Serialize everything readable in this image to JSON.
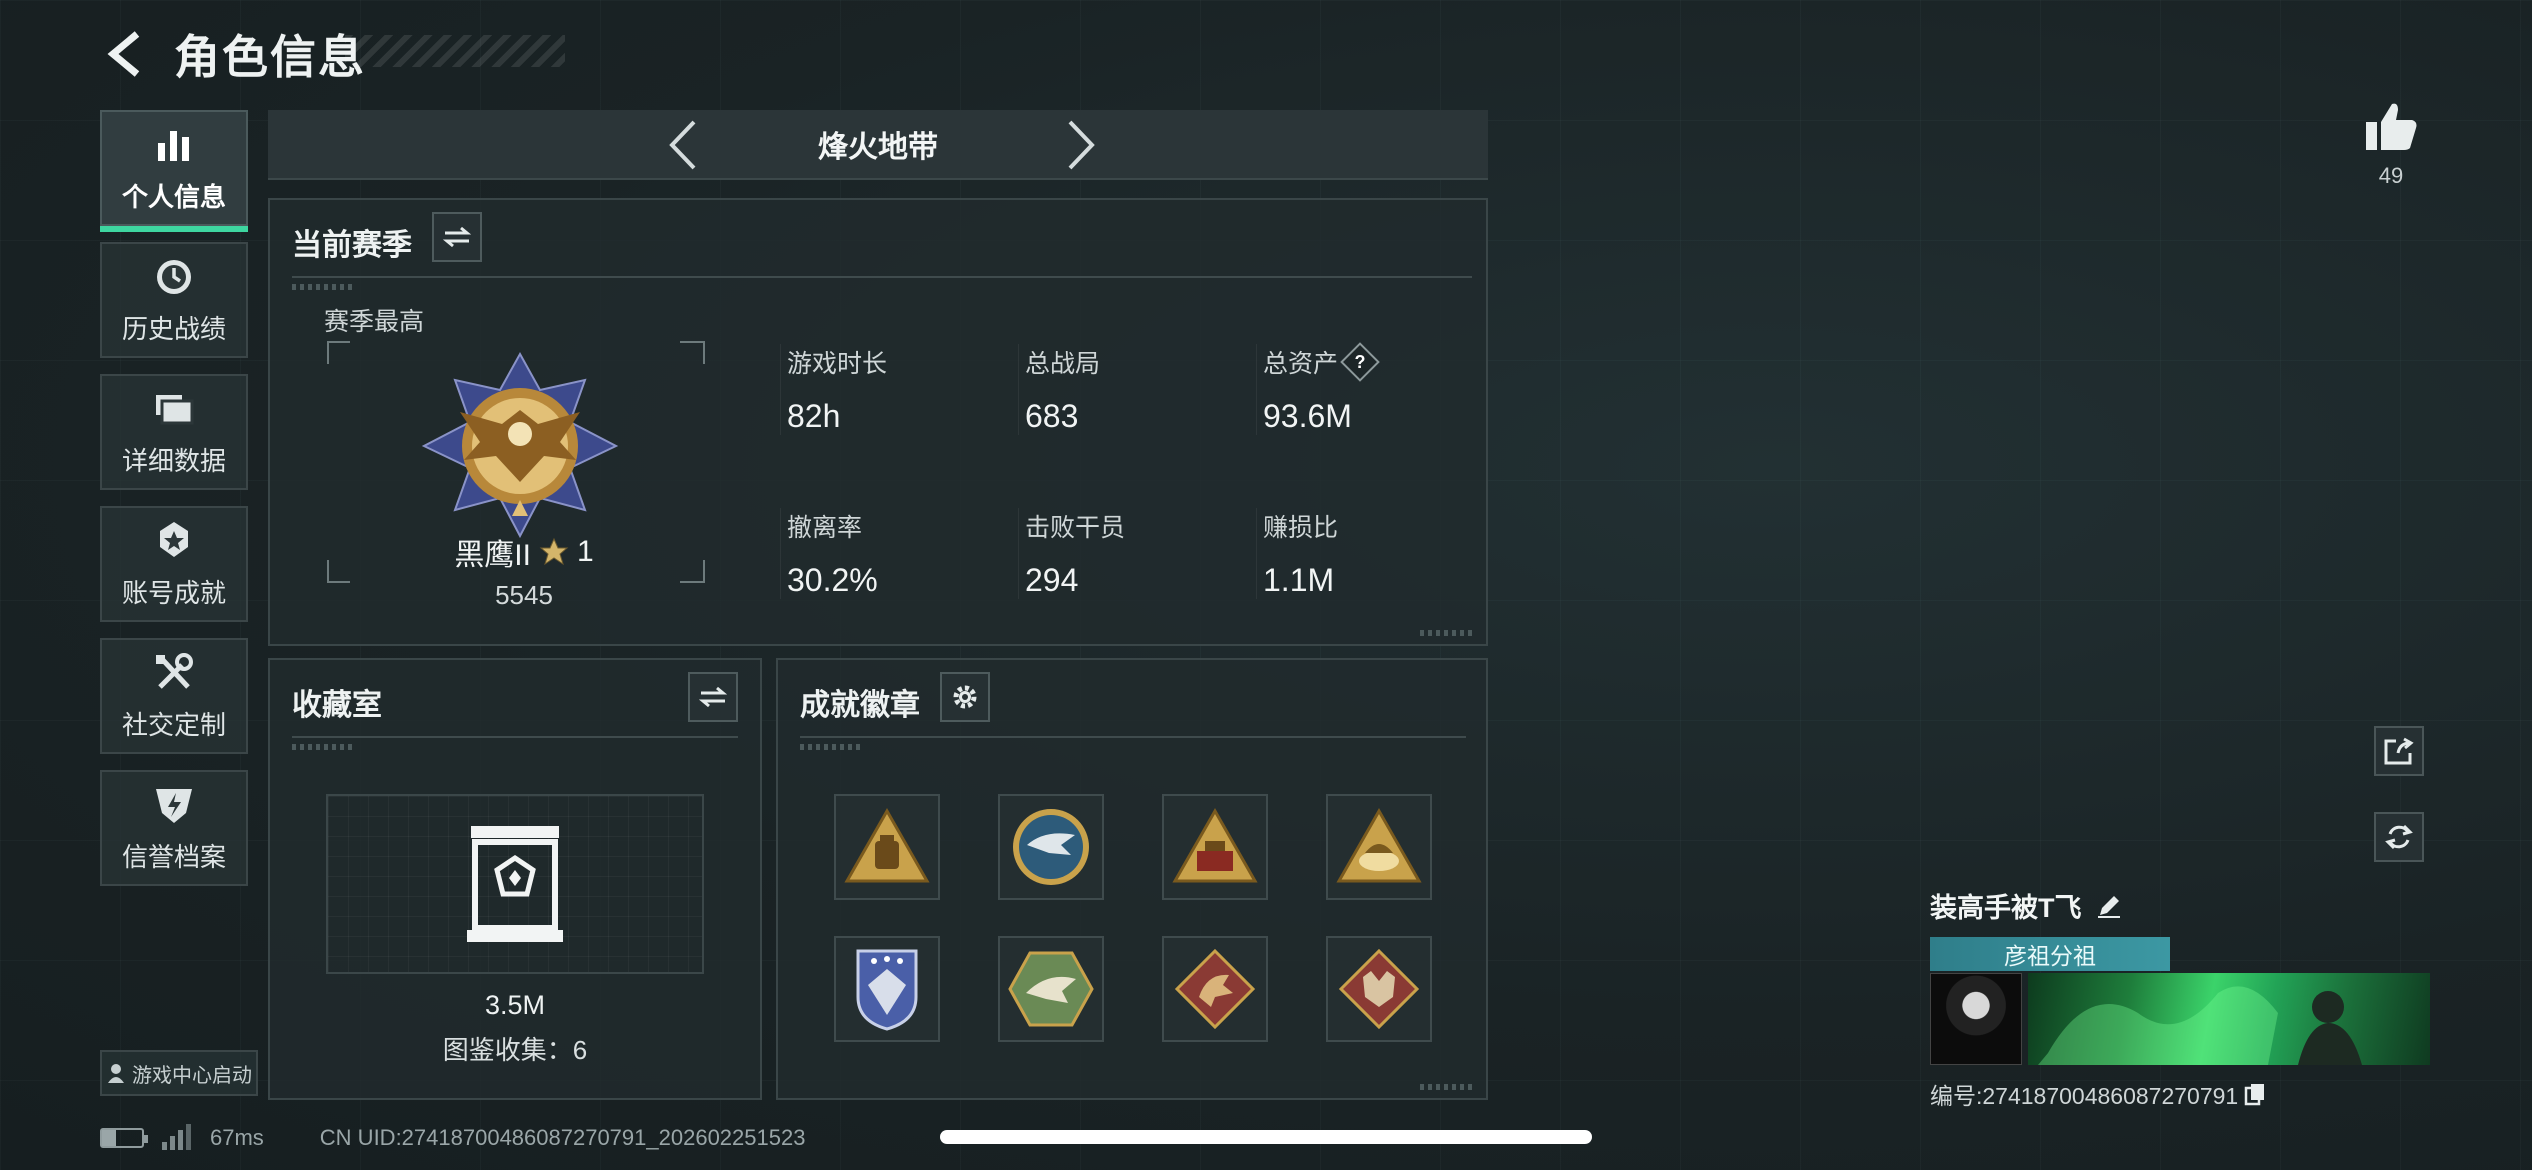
{
  "header": {
    "title": "角色信息"
  },
  "nav": {
    "items": [
      {
        "label": "个人信息",
        "icon": "bar-chart-icon",
        "active": true
      },
      {
        "label": "历史战绩",
        "icon": "clock-icon",
        "active": false
      },
      {
        "label": "详细数据",
        "icon": "folders-icon",
        "active": false
      },
      {
        "label": "账号成就",
        "icon": "medal-icon",
        "active": false
      },
      {
        "label": "社交定制",
        "icon": "tools-icon",
        "active": false
      },
      {
        "label": "信誉档案",
        "icon": "shield-icon",
        "active": false
      }
    ],
    "launch_label": "游戏中心启动"
  },
  "mode": {
    "title": "烽火地带"
  },
  "season": {
    "title": "当前赛季",
    "best_label": "赛季最高",
    "rank_name": "黑鹰II",
    "rank_stars": "1",
    "rank_points": "5545",
    "stats": [
      {
        "label": "游戏时长",
        "value": "82h"
      },
      {
        "label": "总战局",
        "value": "683"
      },
      {
        "label": "总资产",
        "value": "93.6M",
        "help": "?"
      },
      {
        "label": "撤离率",
        "value": "30.2%"
      },
      {
        "label": "击败干员",
        "value": "294"
      },
      {
        "label": "赚损比",
        "value": "1.1M"
      }
    ]
  },
  "collection": {
    "title": "收藏室",
    "value": "3.5M",
    "collect_label": "图鉴收集：6"
  },
  "badges": {
    "title": "成就徽章",
    "items": [
      {
        "icon": "bag-triangle-badge-icon",
        "color": "#c9a24b"
      },
      {
        "icon": "eagle-circle-badge-icon",
        "color": "#2d5b7a"
      },
      {
        "icon": "device-triangle-badge-icon",
        "color": "#c9a24b"
      },
      {
        "icon": "bird-triangle-badge-icon",
        "color": "#c9a24b"
      },
      {
        "icon": "shield-stars-badge-icon",
        "color": "#4a5fa8"
      },
      {
        "icon": "eagle-hexagon-badge-icon",
        "color": "#6a8a55"
      },
      {
        "icon": "dragon-diamond-badge-icon",
        "color": "#8a3a34"
      },
      {
        "icon": "wolf-diamond-badge-icon",
        "color": "#8a3a34"
      }
    ]
  },
  "likes": {
    "count": "49"
  },
  "profile": {
    "name": "装高手被T飞",
    "team": "彦祖分祖",
    "uid_text": "编号:2741870048608727079​1"
  },
  "status": {
    "ping": "67ms",
    "cn_uid": "CN UID:2741870048608727079​1_202602251523",
    "battery_level": 0.35
  },
  "colors": {
    "accent": "#3ed6a0",
    "panel_border": "#3a4648",
    "gold": "#c9a24b"
  }
}
